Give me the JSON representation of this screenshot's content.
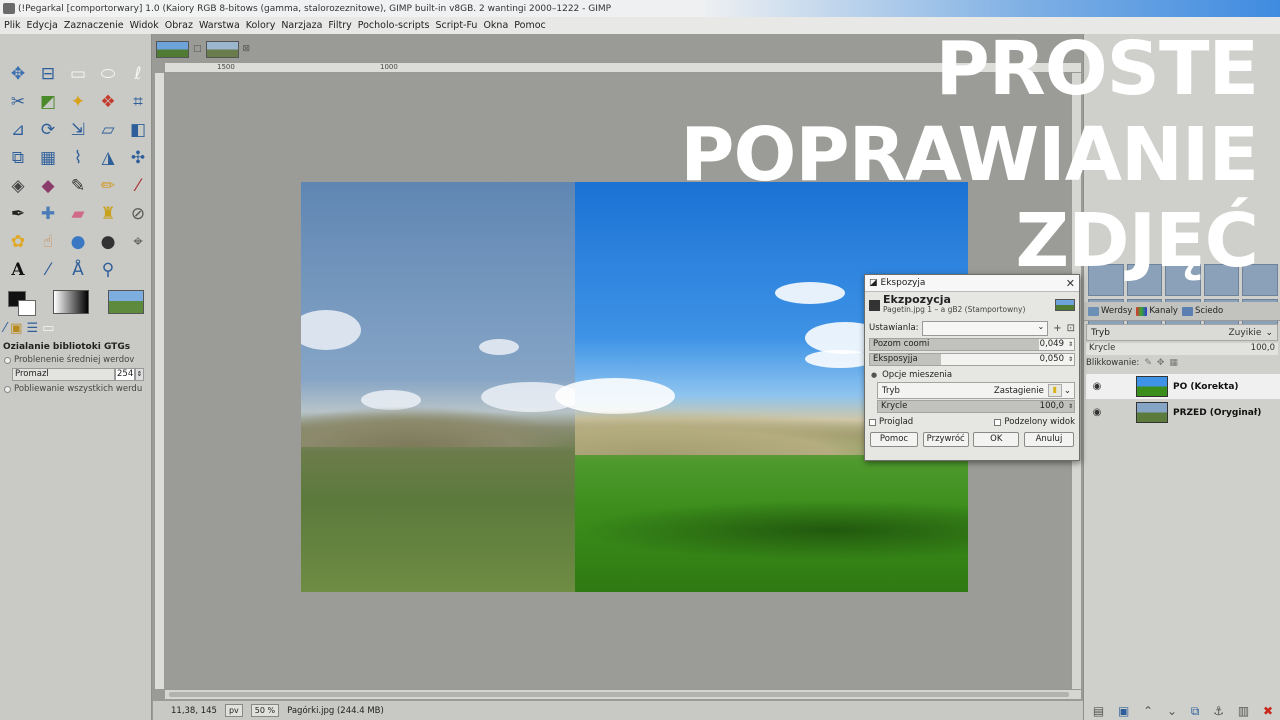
{
  "window": {
    "title": "(!Pegarkal [comportorwary] 1.0 (Kaiory RGB 8-bitows (gamma, stalorozeznitowe), GIMP built-in v8GB. 2 wantingi 2000–1222 - GIMP"
  },
  "menu": [
    "Plik",
    "Edycja",
    "Zaznaczenie",
    "Widok",
    "Obraz",
    "Warstwa",
    "Kolory",
    "Narzjaza",
    "Filtry",
    "Pocholo-scripts",
    "Script-Fu",
    "Okna",
    "Pomoc"
  ],
  "ruler": {
    "tick1": "1500",
    "tick2": "1000"
  },
  "tool_options": {
    "title": "Ozialanie bibliotoki GTGs",
    "option1": "Problenenie średniej werdov",
    "field_label": "Promazl",
    "field_value": "254",
    "option2": "Pobliewanie wszystkich werdu"
  },
  "status": {
    "coords": "11,38, 145",
    "unit": "pv",
    "zoom": "50 %",
    "file": "Pagórki.jpg (244.4 MB)"
  },
  "headline": [
    "PROSTE",
    "POPRAWIANIE",
    "ZDJĘĆ"
  ],
  "dialog": {
    "title": "Ekspozyja",
    "heading": "Ekzpozycja",
    "subheading": "Pagetin.jpg 1 – a gB2 (Stamportowny)",
    "presets_label": "Ustawianla:",
    "black_level_label": "Pozom coomi",
    "black_level_value": "0,049",
    "black_level_fraction": 0.83,
    "exposure_label": "Eksposyjja",
    "exposure_value": "0,050",
    "exposure_fraction": 0.35,
    "blending_label": "Opcje mieszenia",
    "mode_label": "Tryb",
    "mode_value": "Zastagienie",
    "opacity_label": "Krycle",
    "opacity_value": "100,0",
    "preview_label": "Proiglad",
    "split_label": "Podzelony widok",
    "buttons": {
      "help": "Pomoc",
      "reset": "Przywróć",
      "ok": "OK",
      "cancel": "Anuluj"
    }
  },
  "layers_panel": {
    "tabs": [
      "Werdsy",
      "Kanaly",
      "Sciedo"
    ],
    "mode_label": "Tryb",
    "mode_value": "Zuyikie",
    "opacity_label": "Krycle",
    "opacity_value": "100,0",
    "lock_label": "Blikkowanie:",
    "layers": [
      {
        "name": "PO (Korekta)",
        "selected": true
      },
      {
        "name": "PRZED (Oryginał)",
        "selected": false
      }
    ]
  },
  "colors": {
    "headline": "#ffffff",
    "sky_after": "#1c72d4",
    "grass_after": "#3c8e1c"
  }
}
